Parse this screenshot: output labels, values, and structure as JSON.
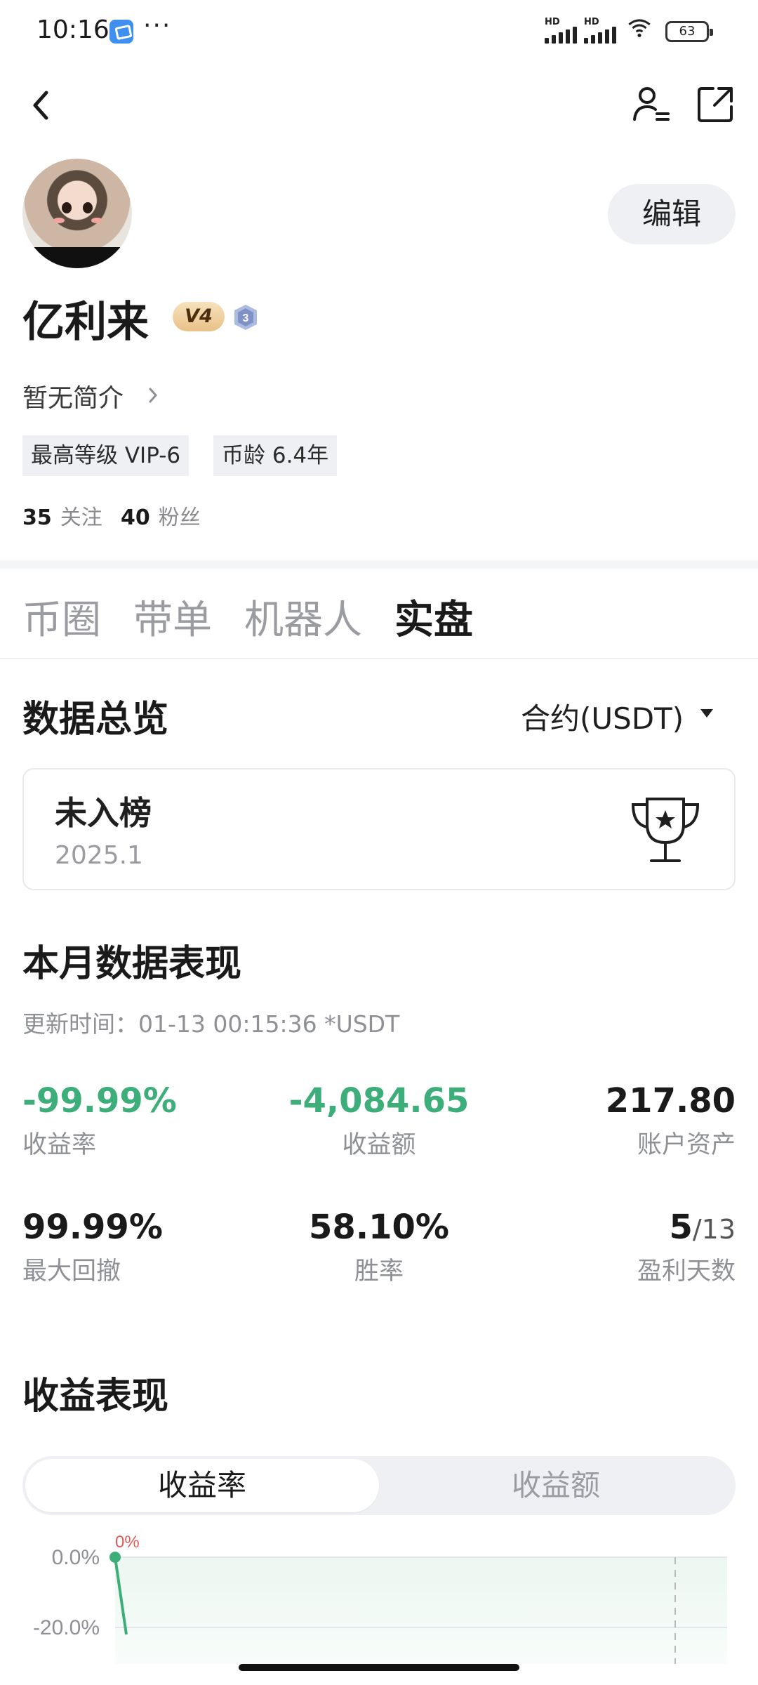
{
  "status_bar": {
    "time": "10:16",
    "more": "···",
    "network": "HD",
    "battery": "63"
  },
  "header": {
    "back_icon": "chevron-left-icon",
    "profile_icon": "user-settings-icon",
    "share_icon": "share-icon"
  },
  "profile": {
    "name": "亿利来",
    "vip_badge": "V4",
    "level_badge": "3",
    "bio": "暂无简介",
    "edit_label": "编辑",
    "tags": [
      "最高等级 VIP-6",
      "币龄 6.4年"
    ],
    "following_count": "35",
    "following_label": "关注",
    "followers_count": "40",
    "followers_label": "粉丝"
  },
  "tabs": [
    "币圈",
    "带单",
    "机器人",
    "实盘"
  ],
  "active_tab": "实盘",
  "overview": {
    "title": "数据总览",
    "contract_select": "合约(USDT)",
    "rank_status": "未入榜",
    "rank_period": "2025.1"
  },
  "monthly": {
    "title": "本月数据表现",
    "update_text": "更新时间：01-13 00:15:36  *USDT",
    "metrics": [
      {
        "value": "-99.99%",
        "label": "收益率"
      },
      {
        "value": "-4,084.65",
        "label": "收益额"
      },
      {
        "value": "217.80",
        "label": "账户资产"
      },
      {
        "value": "99.99%",
        "label": "最大回撤"
      },
      {
        "value": "58.10%",
        "label": "胜率"
      },
      {
        "value": "5",
        "value_total": "/13",
        "label": "盈利天数"
      }
    ]
  },
  "performance": {
    "title": "收益表现",
    "segments": [
      "收益率",
      "收益额"
    ],
    "active_segment": "收益率"
  },
  "chart_data": {
    "type": "line",
    "y_ticks": [
      "0.0%",
      "-20.0%"
    ],
    "point_label": "0%",
    "x": [
      1,
      2
    ],
    "series": [
      {
        "values": [
          0.0,
          -22.0
        ]
      }
    ],
    "ylim": [
      -22,
      0
    ],
    "colors": {
      "line": "#3dae7a",
      "point_label": "#e05a5a"
    }
  },
  "colors": {
    "negative": "#3dae7a",
    "accent_bg": "#eef0f4"
  }
}
